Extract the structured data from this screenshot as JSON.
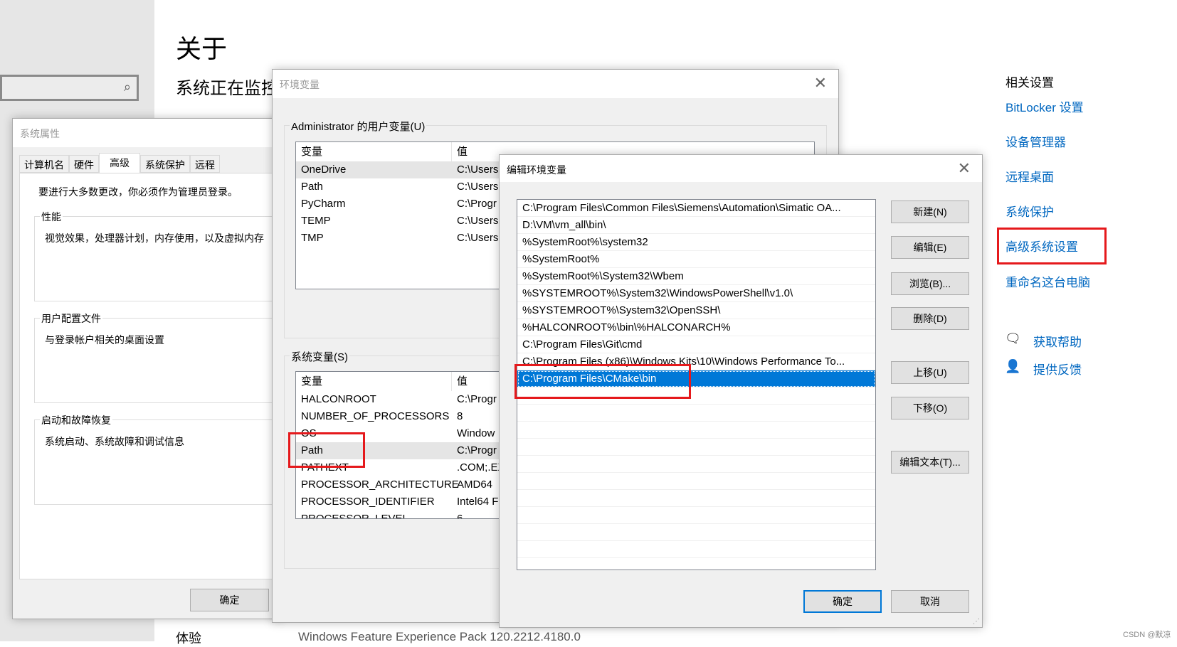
{
  "settings": {
    "title": "关于",
    "subtitle": "系统正在监控并保护你的电脑。",
    "related_heading": "相关设置",
    "links": [
      "BitLocker 设置",
      "设备管理器",
      "远程桌面",
      "系统保护",
      "高级系统设置",
      "重命名这台电脑"
    ],
    "help": "获取帮助",
    "feedback": "提供反馈",
    "bottom_label": "体验",
    "bottom_value": "Windows Feature Experience Pack 120.2212.4180.0"
  },
  "watermark": "CSDN @默凉",
  "sysprops": {
    "title": "系统属性",
    "tabs": [
      "计算机名",
      "硬件",
      "高级",
      "系统保护",
      "远程"
    ],
    "active_tab": 2,
    "admin_note": "要进行大多数更改，你必须作为管理员登录。",
    "groups": [
      {
        "label": "性能",
        "desc": "视觉效果，处理器计划，内存使用，以及虚拟内存"
      },
      {
        "label": "用户配置文件",
        "desc": "与登录帐户相关的桌面设置"
      },
      {
        "label": "启动和故障恢复",
        "desc": "系统启动、系统故障和调试信息"
      }
    ],
    "ok": "确定"
  },
  "envvars": {
    "title": "环境变量",
    "user_group": "Administrator 的用户变量(U)",
    "system_group": "系统变量(S)",
    "col_var": "变量",
    "col_val": "值",
    "user_rows": [
      [
        "OneDrive",
        "C:\\Users"
      ],
      [
        "Path",
        "C:\\Users"
      ],
      [
        "PyCharm",
        "C:\\Progr"
      ],
      [
        "TEMP",
        "C:\\Users"
      ],
      [
        "TMP",
        "C:\\Users"
      ]
    ],
    "system_rows": [
      [
        "HALCONROOT",
        "C:\\Progr"
      ],
      [
        "NUMBER_OF_PROCESSORS",
        "8"
      ],
      [
        "OS",
        "Window"
      ],
      [
        "Path",
        "C:\\Progr"
      ],
      [
        "PATHEXT",
        ".COM;.EX"
      ],
      [
        "PROCESSOR_ARCHITECTURE",
        "AMD64"
      ],
      [
        "PROCESSOR_IDENTIFIER",
        "Intel64 F"
      ],
      [
        "PROCESSOR_LEVEL",
        "6"
      ]
    ]
  },
  "editenv": {
    "title": "编辑环境变量",
    "entries": [
      "C:\\Program Files\\Common Files\\Siemens\\Automation\\Simatic OA...",
      "D:\\VM\\vm_all\\bin\\",
      "%SystemRoot%\\system32",
      "%SystemRoot%",
      "%SystemRoot%\\System32\\Wbem",
      "%SYSTEMROOT%\\System32\\WindowsPowerShell\\v1.0\\",
      "%SYSTEMROOT%\\System32\\OpenSSH\\",
      "%HALCONROOT%\\bin\\%HALCONARCH%",
      "C:\\Program Files\\Git\\cmd",
      "C:\\Program Files (x86)\\Windows Kits\\10\\Windows Performance To...",
      "C:\\Program Files\\CMake\\bin"
    ],
    "selected_index": 10,
    "buttons": {
      "new": "新建(N)",
      "edit": "编辑(E)",
      "browse": "浏览(B)...",
      "delete": "删除(D)",
      "up": "上移(U)",
      "down": "下移(O)",
      "edit_text": "编辑文本(T)..."
    },
    "ok": "确定",
    "cancel": "取消"
  },
  "colors": {
    "accent": "#0078d7",
    "link": "#0067c0",
    "highlight": "#e5191c"
  }
}
